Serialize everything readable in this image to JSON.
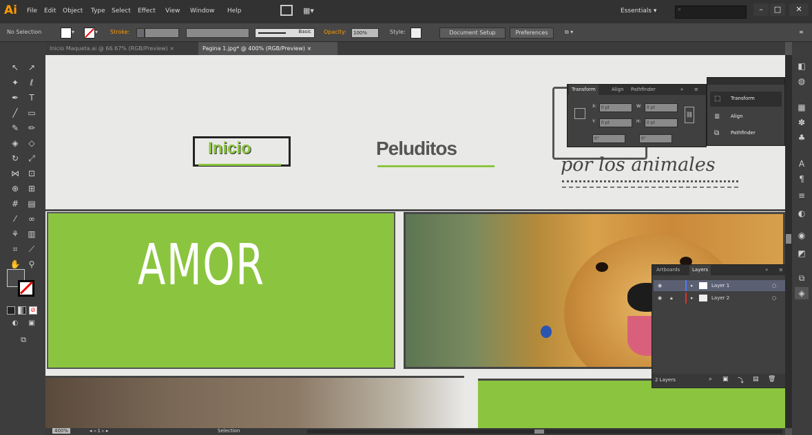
{
  "app": {
    "logo": "Ai"
  },
  "menu": [
    "File",
    "Edit",
    "Object",
    "Type",
    "Select",
    "Effect",
    "View",
    "Window",
    "Help"
  ],
  "workspace": {
    "label": "Essentials",
    "search_placeholder": ""
  },
  "window_controls": {
    "minimize": "–",
    "restore": "□",
    "close": "✕"
  },
  "control_bar": {
    "selection": "No Selection",
    "stroke_label": "Stroke:",
    "stroke_style": "Basic",
    "opacity_label": "Opacity:",
    "opacity_value": "100%",
    "style_label": "Style:",
    "document_setup": "Document Setup",
    "preferences": "Preferences"
  },
  "tabs": [
    {
      "label": "Inicio Maqueta.ai @ 66.67% (RGB/Preview)",
      "active": false
    },
    {
      "label": "Pagina 1.jpg* @ 400% (RGB/Preview)",
      "active": true
    }
  ],
  "canvas": {
    "nav_inicio": "Inicio",
    "nav_peluditos": "Peluditos",
    "sketch_line1": "por los animales",
    "sketch_line2": "",
    "amor": "AMOR",
    "accent_color": "#8bc53f"
  },
  "transform_panel": {
    "tabs": [
      "Transform",
      "Align",
      "Pathfinder"
    ],
    "x_label": "X:",
    "x_value": "0 pt",
    "y_label": "Y:",
    "y_value": "0 pt",
    "w_label": "W:",
    "w_value": "0 pt",
    "h_label": "H:",
    "h_value": "0 pt",
    "angle_value": "0°",
    "shear_value": "0°"
  },
  "mini_panel": {
    "items": [
      "Transform",
      "Align",
      "Pathfinder"
    ]
  },
  "layers_panel": {
    "tabs": [
      "Artboards",
      "Layers"
    ],
    "layers": [
      {
        "name": "Layer 1",
        "color": "#4f7cff"
      },
      {
        "name": "Layer 2",
        "color": "#e03030"
      }
    ],
    "footer": "2 Layers"
  },
  "status": {
    "zoom": "400%",
    "page": "1",
    "tool": "Selection"
  }
}
